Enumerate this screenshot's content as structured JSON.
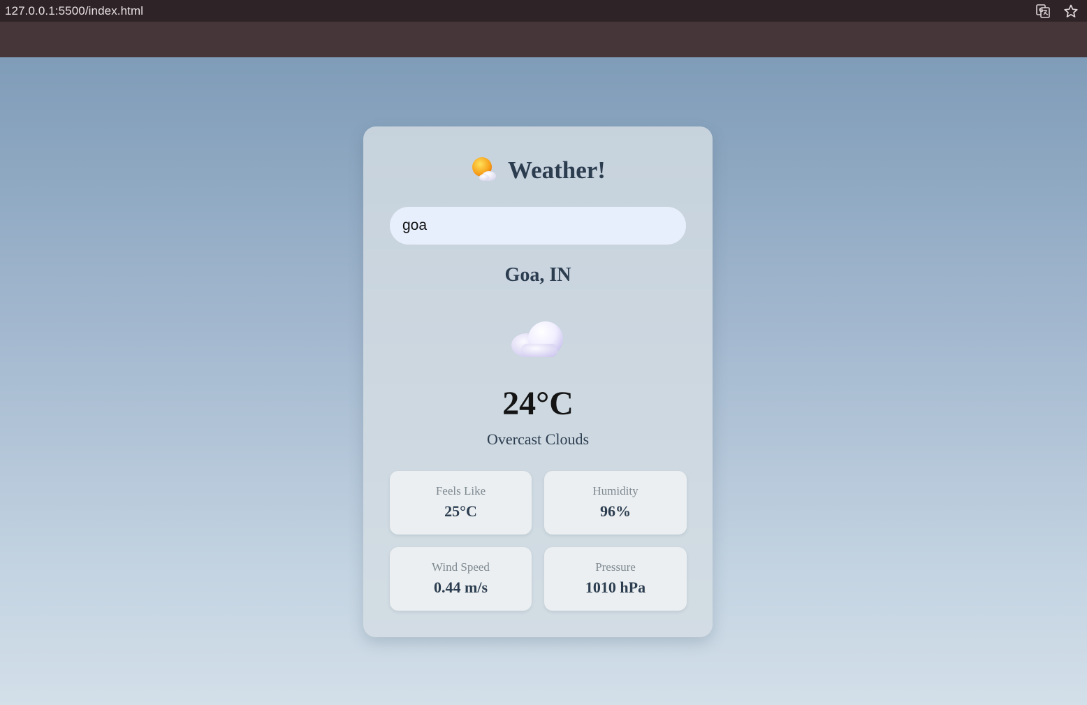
{
  "browser": {
    "url": "127.0.0.1:5500/index.html",
    "icons": [
      "translate-icon",
      "bookmark-star-icon"
    ]
  },
  "app": {
    "title": "Weather!",
    "title_icon": "sun-behind-cloud-icon"
  },
  "search": {
    "value": "goa"
  },
  "weather": {
    "location": "Goa, IN",
    "condition_icon": "cloud-icon",
    "temperature": "24°C",
    "description": "Overcast Clouds"
  },
  "stats": [
    {
      "label": "Feels Like",
      "value": "25°C"
    },
    {
      "label": "Humidity",
      "value": "96%"
    },
    {
      "label": "Wind Speed",
      "value": "0.44 m/s"
    },
    {
      "label": "Pressure",
      "value": "1010 hPa"
    }
  ],
  "colors": {
    "card_text": "#2c3d50",
    "input_bg": "#e8effc",
    "background_top": "#7f9cb8",
    "background_bottom": "#d3dfe9"
  }
}
